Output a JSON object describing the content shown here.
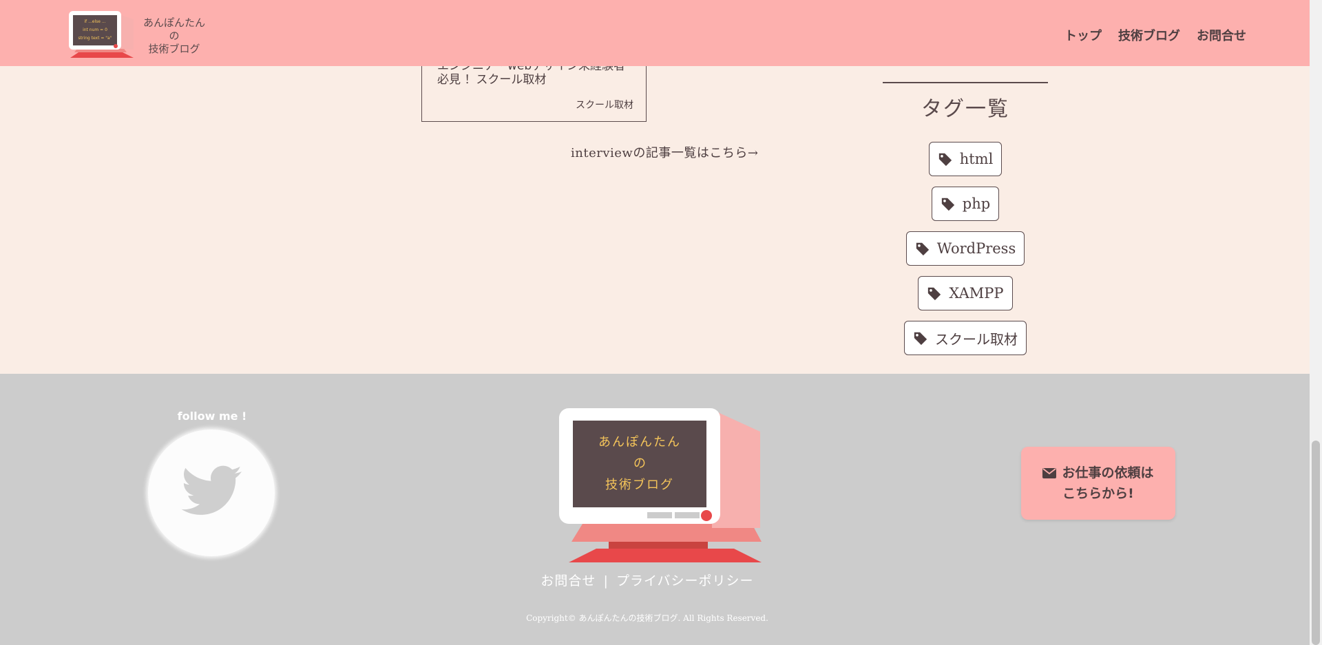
{
  "header": {
    "site_title_lines": [
      "あんぽんたん",
      "の",
      "技術ブログ"
    ],
    "logo_screen_lines": [
      "if ...else ...",
      "int num = 0",
      "string text = \"a\""
    ],
    "nav": [
      "トップ",
      "技術ブログ",
      "お問合せ"
    ]
  },
  "main": {
    "card": {
      "title": "エンジニア・webデザイン未経験者必見 ！スクール取材",
      "tag": "スクール取材"
    },
    "more_link": "interviewの記事一覧はこちら→"
  },
  "sidebar": {
    "heading": "タグ一覧",
    "tags": [
      "html",
      "php",
      "WordPress",
      "XAMPP",
      "スクール取材"
    ],
    "tag_icon": "tag-icon"
  },
  "footer": {
    "follow_text": "follow me !",
    "social_icon": "twitter-icon",
    "monitor_lines": [
      "あんぽんたん",
      "の",
      "技術ブログ"
    ],
    "links": [
      "お問合せ",
      "プライバシーポリシー"
    ],
    "separator": "|",
    "copyright": "Copyright© あんぽんたんの技術ブログ. All Rights Reserved.",
    "cta_lines": [
      "お仕事の依頼は",
      "こちらから!"
    ],
    "cta_icon": "envelope-icon"
  },
  "colors": {
    "header_bg": "#fdb0ae",
    "page_bg": "#faede5",
    "footer_bg": "#cccccc",
    "text": "#5a4a4c",
    "monitor_screen": "#5a4a4c",
    "monitor_text": "#f5c55a",
    "accent_red": "#e8484a"
  }
}
